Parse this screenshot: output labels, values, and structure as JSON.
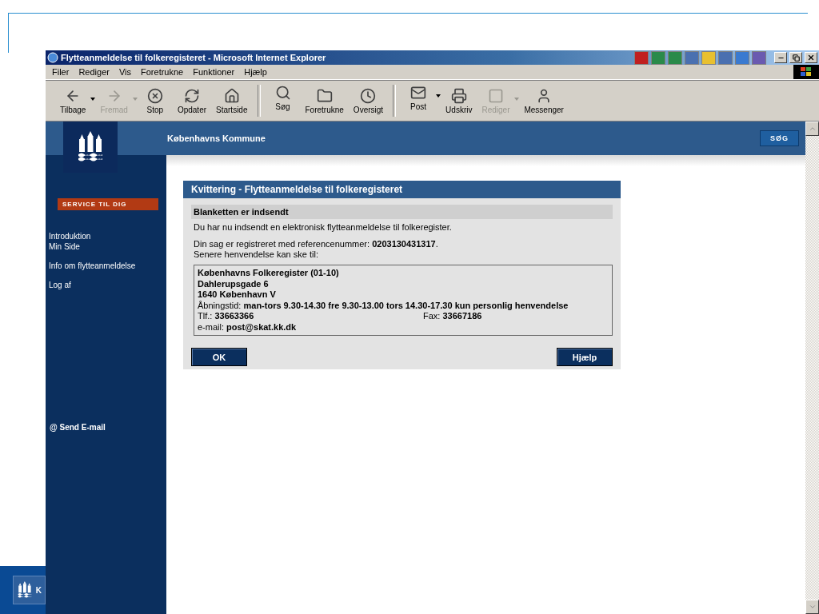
{
  "window": {
    "title": "Flytteanmeldelse til folkeregisteret - Microsoft Internet Explorer"
  },
  "menu": [
    "Filer",
    "Rediger",
    "Vis",
    "Foretrukne",
    "Funktioner",
    "Hjælp"
  ],
  "toolbar": [
    {
      "kind": "back",
      "label": "Tilbage",
      "disabled": false,
      "dropdown": true,
      "separator_before": false
    },
    {
      "kind": "forward",
      "label": "Fremad",
      "disabled": true,
      "dropdown": true,
      "separator_before": false
    },
    {
      "kind": "stop",
      "label": "Stop",
      "disabled": false,
      "dropdown": false,
      "separator_before": false
    },
    {
      "kind": "refresh",
      "label": "Opdater",
      "disabled": false,
      "dropdown": false,
      "separator_before": false
    },
    {
      "kind": "home",
      "label": "Startside",
      "disabled": false,
      "dropdown": false,
      "separator_before": false
    },
    {
      "kind": "search",
      "label": "Søg",
      "disabled": false,
      "dropdown": false,
      "separator_before": true
    },
    {
      "kind": "favorites",
      "label": "Foretrukne",
      "disabled": false,
      "dropdown": false,
      "separator_before": false
    },
    {
      "kind": "history",
      "label": "Oversigt",
      "disabled": false,
      "dropdown": false,
      "separator_before": false
    },
    {
      "kind": "mail",
      "label": "Post",
      "disabled": false,
      "dropdown": true,
      "separator_before": true
    },
    {
      "kind": "print",
      "label": "Udskriv",
      "disabled": false,
      "dropdown": false,
      "separator_before": false
    },
    {
      "kind": "edit",
      "label": "Rediger",
      "disabled": true,
      "dropdown": true,
      "separator_before": false
    },
    {
      "kind": "messenger",
      "label": "Messenger",
      "disabled": false,
      "dropdown": false,
      "separator_before": false
    }
  ],
  "header": {
    "site_name": "Københavns Kommune",
    "search_button": "SØG"
  },
  "sidebar": {
    "section": "SERVICE TIL DIG",
    "link_groups": [
      [
        "Introduktion",
        "Min Side"
      ],
      [
        "Info om flytteanmeldelse"
      ],
      [
        "Log af"
      ]
    ],
    "email_link": "@ Send E-mail"
  },
  "dialog": {
    "title": "Kvittering - Flytteanmeldelse til folkeregisteret",
    "subheading": "Blanketten er indsendt",
    "message": "Du har nu indsendt en elektronisk flytteanmeldelse til folkeregister.",
    "reference": "Din sag er registreret med referencenummer: **0203130431317**.",
    "contact_intro": "Senere henvendelse kan ske til:",
    "address": [
      "Københavns Folkeregister (01-10)",
      "Dahlerupsgade 6",
      "1640 København V"
    ],
    "hours": "Åbningstid: **man-tors 9.30-14.30 fre 9.30-13.00 tors 14.30-17.30 kun personlig henvendelse**",
    "phone": "Tlf.: **33663366**",
    "fax": "Fax: **33667186**",
    "email": "e-mail: **post@skat.kk.dk**",
    "buttons": [
      "OK",
      "Hjælp"
    ]
  },
  "slide_footer": {
    "text": "K"
  }
}
